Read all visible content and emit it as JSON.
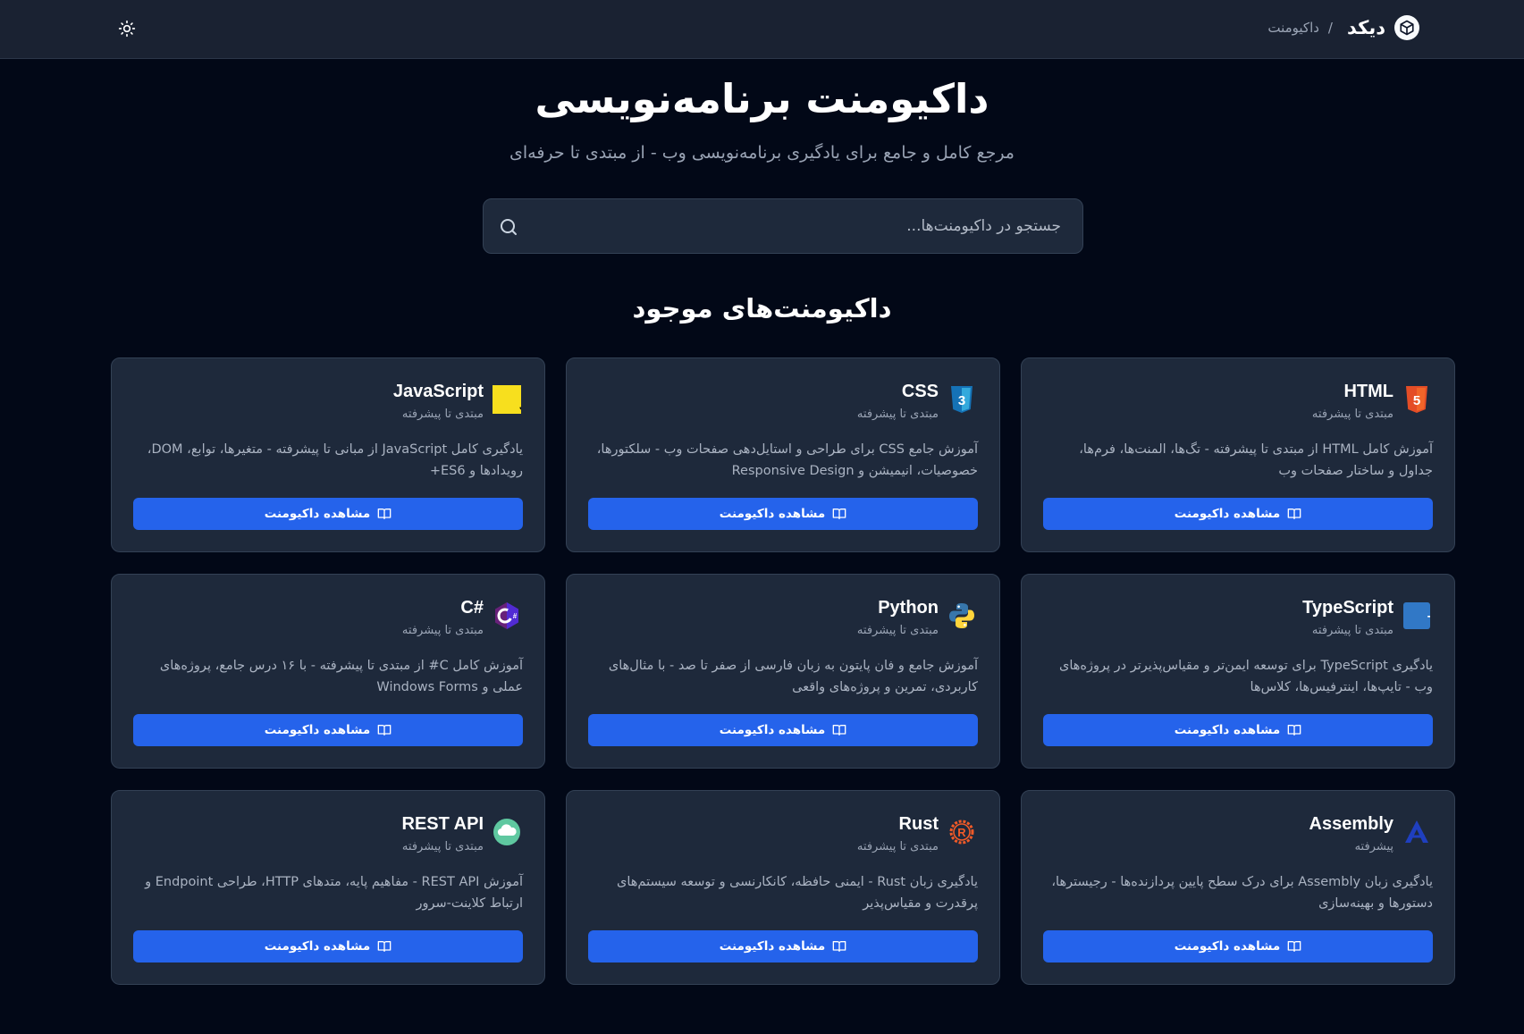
{
  "header": {
    "brand": "دیکد",
    "separator": "/",
    "breadcrumb": "داکیومنت",
    "theme_icon": "sun-icon",
    "logo_icon": "cube-icon"
  },
  "hero": {
    "title": "داکیومنت برنامه‌نویسی",
    "subtitle": "مرجع کامل و جامع برای یادگیری برنامه‌نویسی وب - از مبتدی تا حرفه‌ای"
  },
  "search": {
    "placeholder": "جستجو در داکیومنت‌ها...",
    "value": ""
  },
  "section": {
    "title": "داکیومنت‌های موجود"
  },
  "cards": [
    {
      "title": "HTML",
      "level": "مبتدی تا پیشرفته",
      "description": "آموزش کامل HTML از مبتدی تا پیشرفته - تگ‌ها، المنت‌ها، فرم‌ها، جداول و ساختار صفحات وب",
      "button": "مشاهده داکیومنت",
      "icon": "html5-icon"
    },
    {
      "title": "CSS",
      "level": "مبتدی تا پیشرفته",
      "description": "آموزش جامع CSS برای طراحی و استایل‌دهی صفحات وب - سلکتورها، خصوصیات، انیمیشن و Responsive Design",
      "button": "مشاهده داکیومنت",
      "icon": "css3-icon"
    },
    {
      "title": "JavaScript",
      "level": "مبتدی تا پیشرفته",
      "description": "یادگیری کامل JavaScript از مبانی تا پیشرفته - متغیرها، توابع، DOM، رویدادها و ES6+",
      "button": "مشاهده داکیومنت",
      "icon": "javascript-icon"
    },
    {
      "title": "TypeScript",
      "level": "مبتدی تا پیشرفته",
      "description": "یادگیری TypeScript برای توسعه ایمن‌تر و مقیاس‌پذیرتر در پروژه‌های وب - تایپ‌ها، اینترفیس‌ها، کلاس‌ها",
      "button": "مشاهده داکیومنت",
      "icon": "typescript-icon"
    },
    {
      "title": "Python",
      "level": "مبتدی تا پیشرفته",
      "description": "آموزش جامع و فان پایتون به زبان فارسی از صفر تا صد - با مثال‌های کاربردی، تمرین و پروژه‌های واقعی",
      "button": "مشاهده داکیومنت",
      "icon": "python-icon"
    },
    {
      "title": "C#",
      "level": "مبتدی تا پیشرفته",
      "description": "آموزش کامل C# از مبتدی تا پیشرفته - با ۱۶ درس جامع، پروژه‌های عملی و Windows Forms",
      "button": "مشاهده داکیومنت",
      "icon": "csharp-icon"
    },
    {
      "title": "Assembly",
      "level": "پیشرفته",
      "description": "یادگیری زبان Assembly برای درک سطح پایین پردازنده‌ها - رجیسترها، دستورها و بهینه‌سازی",
      "button": "مشاهده داکیومنت",
      "icon": "assembly-icon"
    },
    {
      "title": "Rust",
      "level": "مبتدی تا پیشرفته",
      "description": "یادگیری زبان Rust - ایمنی حافظه، کانکارنسی و توسعه سیستم‌های پرقدرت و مقیاس‌پذیر",
      "button": "مشاهده داکیومنت",
      "icon": "rust-icon"
    },
    {
      "title": "REST API",
      "level": "مبتدی تا پیشرفته",
      "description": "آموزش REST API - مفاهیم پایه، متدهای HTTP، طراحی Endpoint و ارتباط کلاینت-سرور",
      "button": "مشاهده داکیومنت",
      "icon": "rest-api-icon"
    }
  ],
  "colors": {
    "background": "#020817",
    "header": "#1a2232",
    "card": "#1e293b",
    "accent": "#2563eb"
  }
}
